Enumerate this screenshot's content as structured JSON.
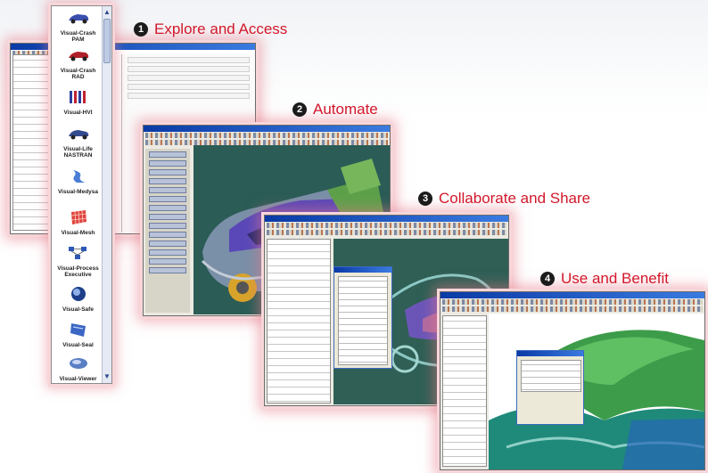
{
  "steps": [
    {
      "num": "1",
      "label": "Explore and Access"
    },
    {
      "num": "2",
      "label": "Automate"
    },
    {
      "num": "3",
      "label": "Collaborate and Share"
    },
    {
      "num": "4",
      "label": "Use and Benefit"
    }
  ],
  "palette": {
    "items": [
      {
        "label": "Visual-Crash PAM",
        "icon": "crash-car-icon"
      },
      {
        "label": "Visual-Crash RAD",
        "icon": "crash-car-red-icon"
      },
      {
        "label": "Visual-HVI",
        "icon": "hvi-bars-icon"
      },
      {
        "label": "Visual-Life NASTRAN",
        "icon": "life-car-icon"
      },
      {
        "label": "Visual-Medysa",
        "icon": "medysa-icon"
      },
      {
        "label": "Visual-Mesh",
        "icon": "mesh-grid-icon"
      },
      {
        "label": "Visual-Process Executive",
        "icon": "process-executive-icon"
      },
      {
        "label": "Visual-Safe",
        "icon": "safe-sphere-icon"
      },
      {
        "label": "Visual-Seal",
        "icon": "seal-icon"
      },
      {
        "label": "Visual-Viewer",
        "icon": "viewer-icon"
      }
    ]
  },
  "colors": {
    "accent": "#d2182b",
    "glow": "#f2a6b0",
    "titlebar": "#0a3aa6",
    "viewport": "#2b5c56"
  }
}
